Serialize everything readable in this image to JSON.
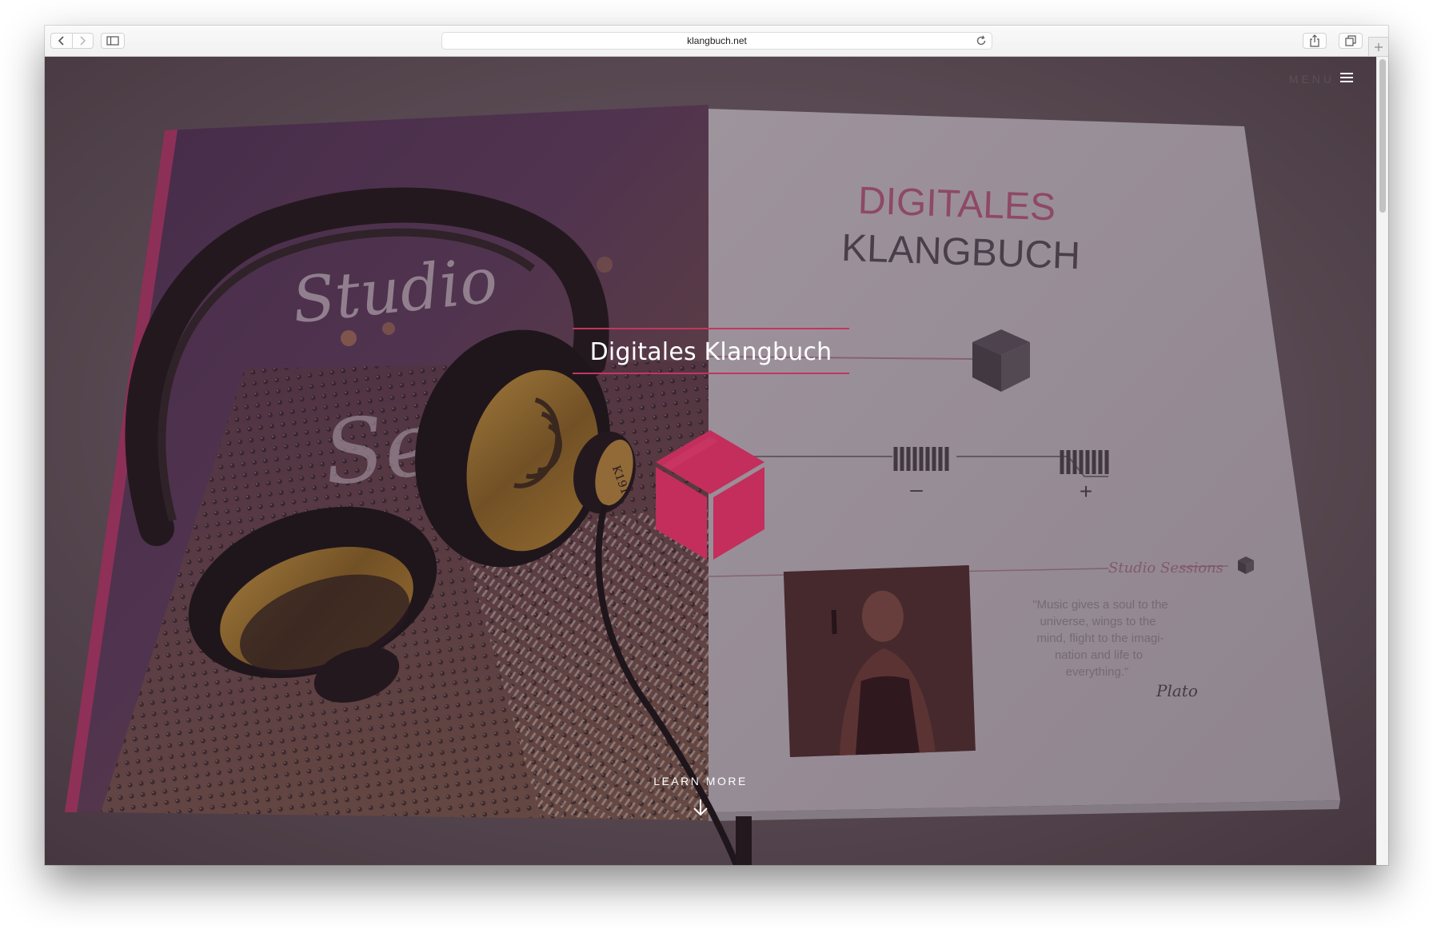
{
  "browser": {
    "url": "klangbuch.net"
  },
  "header": {
    "menu_label": "MENU"
  },
  "hero": {
    "title": "Digitales Klangbuch",
    "cta_label": "LEARN MORE"
  },
  "background_photo": {
    "left_page_text_1": "Studio",
    "left_page_text_2": "Se",
    "headphone_label": "K191",
    "headphone_label_sub": "Studio",
    "right_page_heading_line1": "DIGITALES",
    "right_page_heading_line2": "KLANGBUCH",
    "minus_sign": "–",
    "plus_sign": "+",
    "signature_text": "Studio Sessions",
    "quote_lines": [
      "\"Music gives a soul to the",
      "universe, wings to the",
      "mind, flight to the imagi-",
      "nation and life to",
      "everything.\""
    ],
    "quote_author": "Plato"
  },
  "colors": {
    "accent": "#c2365f",
    "overlay": "#3a2632"
  }
}
